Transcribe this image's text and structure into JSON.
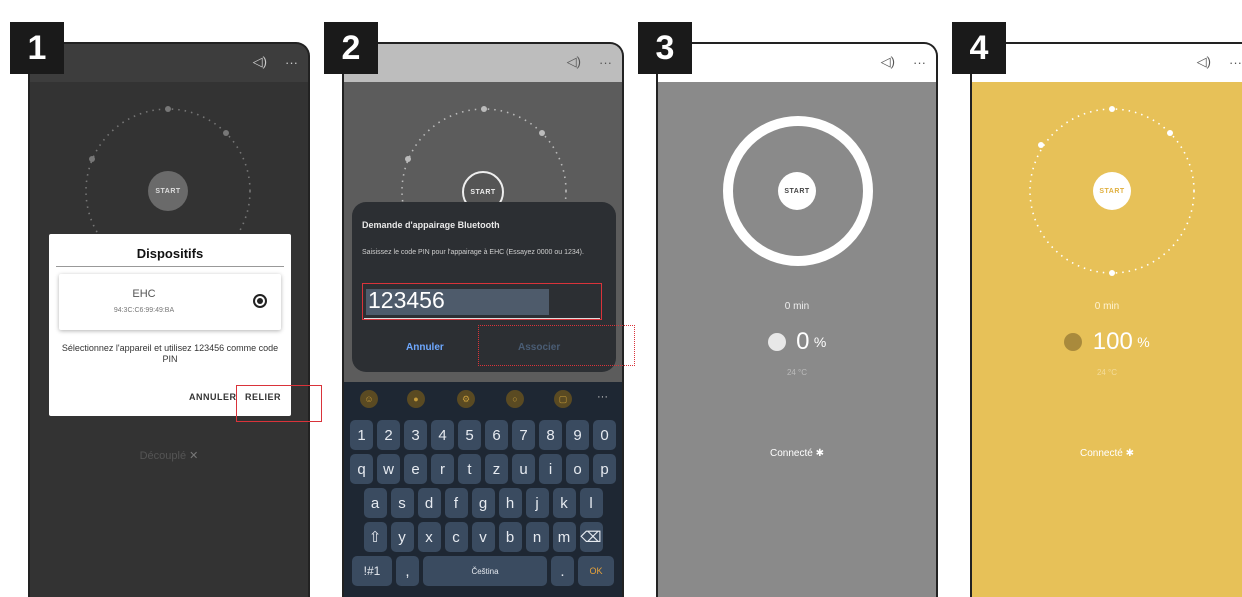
{
  "steps": [
    "1",
    "2",
    "3",
    "4"
  ],
  "topbar": {
    "sound_glyph": "◁)",
    "menu_glyph": "···"
  },
  "start_label": "START",
  "panel1": {
    "dialog_title": "Dispositifs",
    "device_name": "EHC",
    "device_mac": "94:3C:C6:99:49:BA",
    "message": "Sélectionnez l'appareil et utilisez 123456 comme code PIN",
    "cancel_label": "ANNULER",
    "confirm_label": "RELIER",
    "status": "Découplé",
    "status_icon": "bluetooth-disabled-icon"
  },
  "panel2": {
    "dialog_title": "Demande d'appairage Bluetooth",
    "dialog_text": "Saisissez le code PIN pour l'appairage à EHC (Essayez 0000 ou 1234).",
    "pin_value": "123456",
    "cancel_label": "Annuler",
    "confirm_label": "Associer",
    "keyboard": {
      "row1": [
        "1",
        "2",
        "3",
        "4",
        "5",
        "6",
        "7",
        "8",
        "9",
        "0"
      ],
      "row2": [
        "q",
        "w",
        "e",
        "r",
        "t",
        "z",
        "u",
        "i",
        "o",
        "p"
      ],
      "row3": [
        "a",
        "s",
        "d",
        "f",
        "g",
        "h",
        "j",
        "k",
        "l"
      ],
      "row4": [
        "⇧",
        "y",
        "x",
        "c",
        "v",
        "b",
        "n",
        "m",
        "⌫"
      ],
      "symbols": "!#1",
      "comma": ",",
      "space": "Čeština",
      "period": ".",
      "ok": "OK",
      "more": "···"
    }
  },
  "panel3": {
    "time": "0 min",
    "percent": "0",
    "percent_unit": "%",
    "temperature": "24 °C",
    "status": "Connecté",
    "level": 0
  },
  "panel4": {
    "time": "0 min",
    "percent": "100",
    "percent_unit": "%",
    "temperature": "24 °C",
    "status": "Connecté",
    "level": 100
  },
  "colors": {
    "dark_panel": "#333333",
    "grey_panel": "#8a8a8a",
    "yellow_panel": "#e7c158",
    "highlight": "#d9333a",
    "accent_blue": "#6ea8ff"
  }
}
